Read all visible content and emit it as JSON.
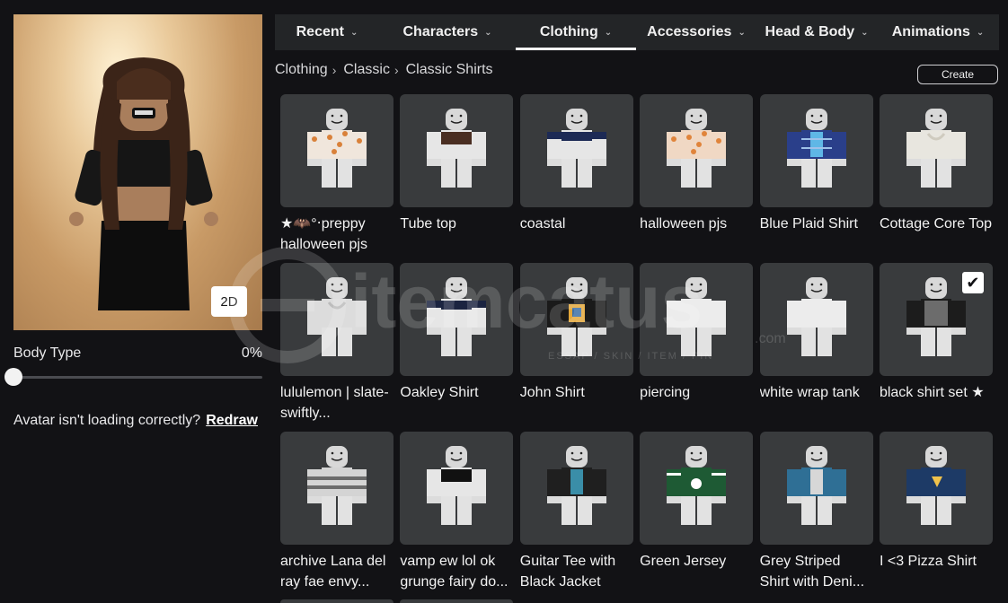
{
  "nav": {
    "tabs": [
      {
        "label": "Recent",
        "active": false
      },
      {
        "label": "Characters",
        "active": false
      },
      {
        "label": "Clothing",
        "active": true
      },
      {
        "label": "Accessories",
        "active": false
      },
      {
        "label": "Head & Body",
        "active": false
      },
      {
        "label": "Animations",
        "active": false
      }
    ]
  },
  "breadcrumb": [
    "Clothing",
    "Classic",
    "Classic Shirts"
  ],
  "create_label": "Create",
  "avatar": {
    "view_toggle_label": "2D",
    "body_type_label": "Body Type",
    "body_type_value": "0%",
    "body_type_level": 0,
    "redraw_text": "Avatar isn't loading correctly?",
    "redraw_link": "Redraw"
  },
  "watermark": {
    "brand": "itemcatus",
    "tagline": "ESSAP / SKIN / ITEM / PIN",
    "domain": ".com"
  },
  "items": [
    {
      "title": "★🦇°‧preppy halloween pjs",
      "shirt": "#f0e6dc",
      "accent": "#d9813a",
      "pattern": "dots",
      "equipped": false
    },
    {
      "title": "Tube top",
      "shirt": "#e6e6e6",
      "accent": "#4a2e22",
      "pattern": "tube",
      "equipped": false
    },
    {
      "title": "coastal",
      "shirt": "#e6e6e6",
      "accent": "#1d2a55",
      "pattern": "band",
      "equipped": false
    },
    {
      "title": "halloween pjs",
      "shirt": "#f0d8c4",
      "accent": "#e0843b",
      "pattern": "dots",
      "equipped": false
    },
    {
      "title": "Blue Plaid Shirt",
      "shirt": "#2a3f8a",
      "accent": "#5fb7e6",
      "pattern": "plaid",
      "equipped": false
    },
    {
      "title": "Cottage Core Top",
      "shirt": "#e8e6df",
      "accent": "#cfcbbf",
      "pattern": "soft",
      "equipped": false
    },
    {
      "title": "lululemon | slate-swiftly...",
      "shirt": "#dcdcdc",
      "accent": "#bcbcbc",
      "pattern": "soft",
      "equipped": false
    },
    {
      "title": "Oakley Shirt",
      "shirt": "#e6e6e6",
      "accent": "#1b2440",
      "pattern": "band",
      "equipped": false
    },
    {
      "title": "John Shirt",
      "shirt": "#1a1a1a",
      "accent": "#e3a73a",
      "pattern": "graphic",
      "equipped": false
    },
    {
      "title": "piercing",
      "shirt": "#ececec",
      "accent": "#ffffff",
      "pattern": "plain",
      "equipped": false
    },
    {
      "title": "white wrap tank",
      "shirt": "#ececec",
      "accent": "#d6d6d6",
      "pattern": "plain",
      "equipped": false
    },
    {
      "title": "black shirt set ★",
      "shirt": "#1c1c1c",
      "accent": "#6c6c6c",
      "pattern": "dark",
      "equipped": true
    },
    {
      "title": "archive Lana del ray fae envy...",
      "shirt": "#d4d4d4",
      "accent": "#6b6b6b",
      "pattern": "stripes",
      "equipped": false
    },
    {
      "title": "vamp ew lol ok grunge fairy do...",
      "shirt": "#e6e6e6",
      "accent": "#111111",
      "pattern": "tube",
      "equipped": false
    },
    {
      "title": "Guitar Tee with Black Jacket",
      "shirt": "#1f1f1f",
      "accent": "#3a8ea8",
      "pattern": "jacket",
      "equipped": false
    },
    {
      "title": "Green Jersey",
      "shirt": "#1e5a34",
      "accent": "#ffffff",
      "pattern": "jersey",
      "equipped": false
    },
    {
      "title": "Grey Striped Shirt with Deni...",
      "shirt": "#2f6f95",
      "accent": "#d7d7d7",
      "pattern": "jacket",
      "equipped": false
    },
    {
      "title": "I <3 Pizza Shirt",
      "shirt": "#1d3a66",
      "accent": "#f0c24b",
      "pattern": "logo",
      "equipped": false
    }
  ]
}
